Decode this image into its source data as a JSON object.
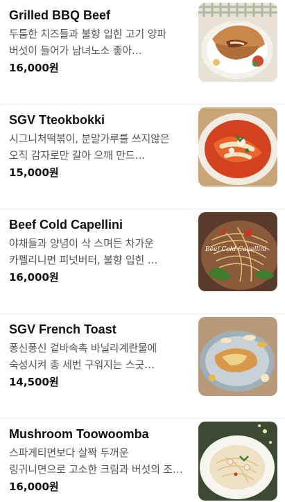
{
  "menu": {
    "items": [
      {
        "name": "Grilled BBQ Beef",
        "description": "두툼한 치즈들과 불향 입힌 고기 양파 버섯이 들어가 남녀노소 좋아…",
        "price": "16,000원",
        "image_icon": "grilled-bbq-beef-photo"
      },
      {
        "name": "SGV Tteokbokki",
        "description": "시그니처떡볶이, 분말가루를 쓰지않은 오직 감자로만 갈아 으깨 만드…",
        "price": "15,000원",
        "image_icon": "tteokbokki-photo"
      },
      {
        "name": "Beef Cold Capellini",
        "description": "야채들과 양념이 삭 스며든 차가운 카펠리니면 피넛버터, 불향 입힌 …",
        "price": "16,000원",
        "image_icon": "cold-capellini-photo",
        "image_caption": "Beef Cold Capellini"
      },
      {
        "name": "SGV French Toast",
        "description": "퐁신퐁신 겉바속촉 바닐라계란물에 숙성시켜 총 세번 구워지는 스긋…",
        "price": "14,500원",
        "image_icon": "french-toast-photo"
      },
      {
        "name": "Mushroom Toowoomba",
        "description": "스파게티면보다 살짝 두꺼운 링귀니면으로 고소한 크림과 버섯의 조…",
        "price": "16,000원",
        "image_icon": "toowoomba-pasta-photo"
      }
    ]
  }
}
